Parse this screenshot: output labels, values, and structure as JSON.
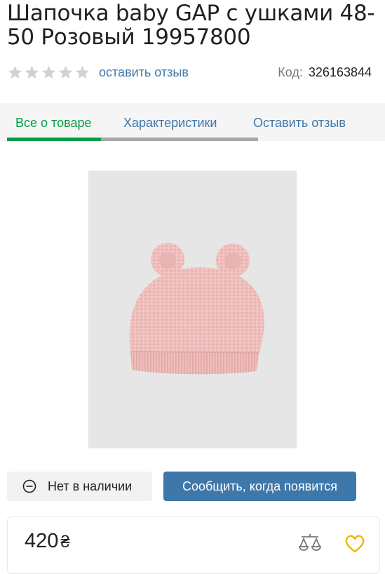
{
  "product": {
    "title": "Шапочка baby GAP с ушками 48-50 Розовый 19957800"
  },
  "rating": {
    "stars": 0,
    "max_stars": 5,
    "review_link": "оставить отзыв"
  },
  "code": {
    "label": "Код:",
    "value": "326163844"
  },
  "tabs": [
    {
      "label": "Все о товаре",
      "active": true
    },
    {
      "label": "Характеристики",
      "active": false
    },
    {
      "label": "Оставить отзыв",
      "active": false
    }
  ],
  "availability": {
    "status": "Нет в наличии",
    "notify_button": "Сообщить, когда появится"
  },
  "price": {
    "value": "420",
    "currency": "₴"
  },
  "colors": {
    "accent_green": "#00a046",
    "link_blue": "#3e77aa",
    "button_blue": "#3e77aa",
    "heart_yellow": "#f1b600",
    "star_empty": "#d2d2d2"
  }
}
